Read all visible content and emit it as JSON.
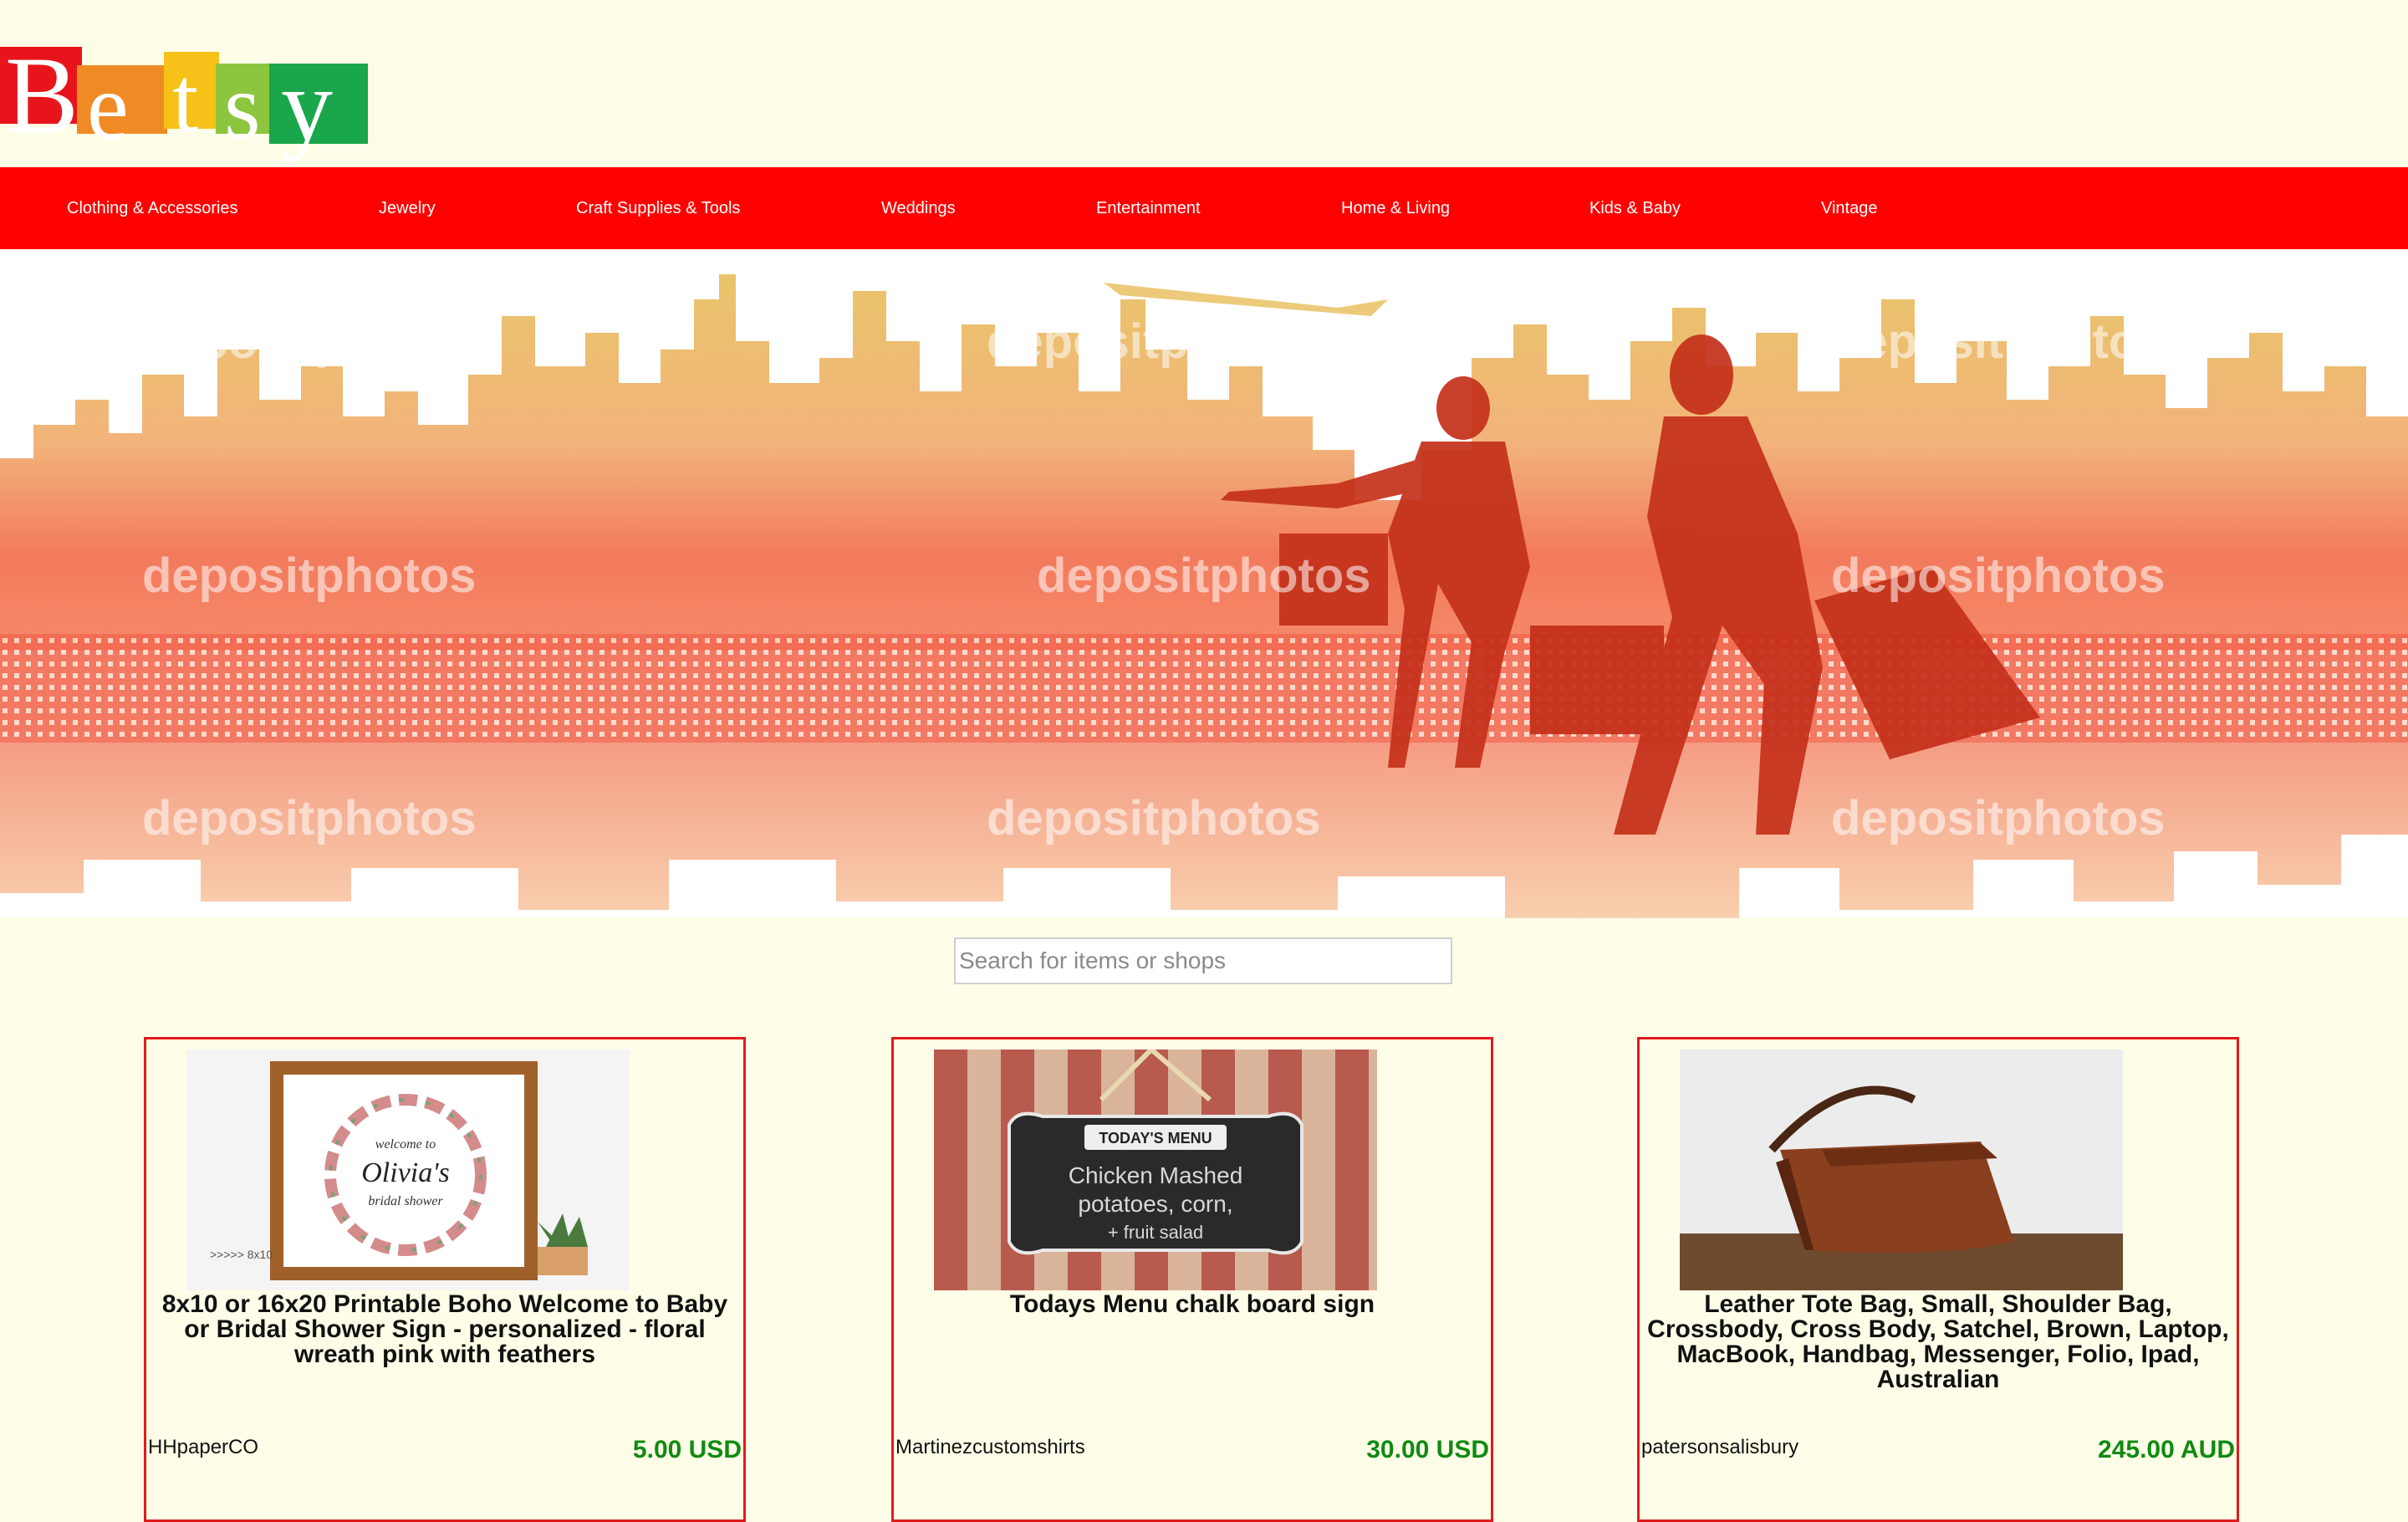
{
  "brand": {
    "letters": [
      "B",
      "e",
      "t",
      "s",
      "y"
    ],
    "tile_colors": [
      "#e8141b",
      "#f08a24",
      "#f6c21a",
      "#8cc63f",
      "#1aa64b"
    ]
  },
  "nav": {
    "items": [
      {
        "label": "Clothing & Accessories"
      },
      {
        "label": "Jewelry"
      },
      {
        "label": "Craft Supplies & Tools"
      },
      {
        "label": "Weddings"
      },
      {
        "label": "Entertainment"
      },
      {
        "label": "Home & Living"
      },
      {
        "label": "Kids & Baby"
      },
      {
        "label": "Vintage"
      }
    ],
    "background": "#ff0000"
  },
  "hero": {
    "watermark": "depositphotos"
  },
  "search": {
    "placeholder": "Search for items or shops"
  },
  "products": [
    {
      "title": "8x10 or 16x20 Printable Boho Welcome to Baby or Bridal Shower Sign - personalized - floral wreath pink with feathers",
      "shop": "HHpaperCO",
      "price": "5.00 USD",
      "image_text": {
        "line1": "welcome to",
        "line2": "Olivia's",
        "line3": "bridal shower",
        "corner": ">>>>> 8x10"
      }
    },
    {
      "title": "Todays Menu chalk board sign",
      "shop": "Martinezcustomshirts",
      "price": "30.00 USD",
      "image_text": {
        "banner": "TODAY'S MENU",
        "line1": "Chicken Mashed",
        "line2": "potatoes, corn,",
        "line3": "+ fruit salad"
      }
    },
    {
      "title": "Leather Tote Bag, Small, Shoulder Bag, Crossbody, Cross Body, Satchel, Brown, Laptop, MacBook, Handbag, Messenger, Folio, Ipad, Australian",
      "shop": "patersonsalisbury",
      "price": "245.00 AUD"
    }
  ],
  "colors": {
    "page_background": "#fefee8",
    "card_border": "#e01b1b",
    "price_green": "#118a11"
  }
}
